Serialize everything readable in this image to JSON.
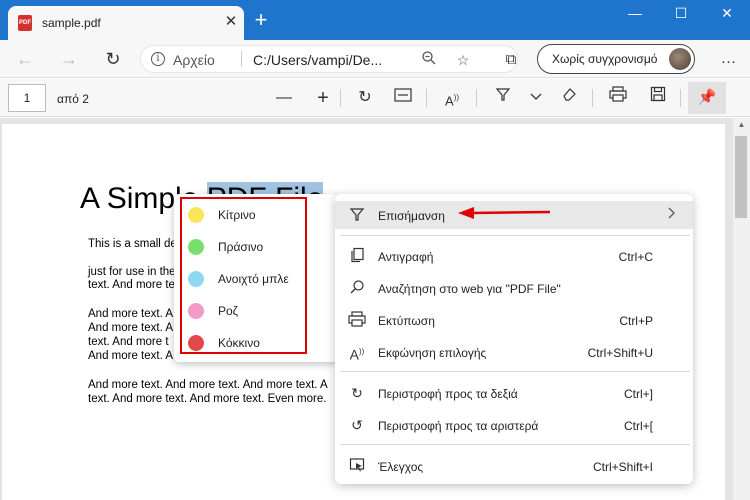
{
  "browser": {
    "tab_title": "sample.pdf",
    "favicon_text": "PDF",
    "address_label": "Αρχείο",
    "url": "C:/Users/vampi/De...",
    "sync_label": "Χωρίς συγχρονισμό",
    "accent_color": "#1f75cc"
  },
  "pdf_toolbar": {
    "page_number": "1",
    "page_of": "από 2"
  },
  "document": {
    "title_before": "A Simple ",
    "title_highlight": "PDF File",
    "lines": [
      "This is a small de",
      "just for use in the",
      "text. And more te",
      "And more text. A",
      "And more text. A",
      "text. And more t",
      "And more text. A",
      "And more text. And more text. And more text. A",
      "text. And more text. And more text. Even more."
    ]
  },
  "highlight_colors": {
    "items": [
      {
        "label": "Κίτρινο",
        "color": "#f8e55a"
      },
      {
        "label": "Πράσινο",
        "color": "#76e06a"
      },
      {
        "label": "Ανοιχτό μπλε",
        "color": "#8ed8f4"
      },
      {
        "label": "Ροζ",
        "color": "#f49ac8"
      },
      {
        "label": "Κόκκινο",
        "color": "#e44848"
      }
    ],
    "frame_color": "#e00000"
  },
  "context_menu": {
    "items": [
      {
        "icon": "highlighter-icon",
        "label": "Επισήμανση",
        "shortcut": "",
        "submenu": true
      },
      {
        "icon": "copy-icon",
        "label": "Αντιγραφή",
        "shortcut": "Ctrl+C"
      },
      {
        "icon": "search-icon",
        "label": "Αναζήτηση στο web για \"PDF File\"",
        "shortcut": ""
      },
      {
        "icon": "print-icon",
        "label": "Εκτύπωση",
        "shortcut": "Ctrl+P"
      },
      {
        "icon": "read-aloud-icon",
        "label": "Εκφώνηση επιλογής",
        "shortcut": "Ctrl+Shift+U"
      },
      {
        "icon": "rotate-right-icon",
        "label": "Περιστροφή προς τα δεξιά",
        "shortcut": "Ctrl+]"
      },
      {
        "icon": "rotate-left-icon",
        "label": "Περιστροφή προς τα αριστερά",
        "shortcut": "Ctrl+["
      },
      {
        "icon": "inspect-icon",
        "label": "Έλεγχος",
        "shortcut": "Ctrl+Shift+I"
      }
    ]
  }
}
